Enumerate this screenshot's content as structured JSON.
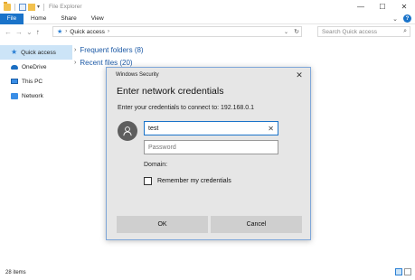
{
  "window": {
    "title": "File Explorer",
    "controls": {
      "minimize": "—",
      "maximize": "☐",
      "close": "✕"
    }
  },
  "ribbon": {
    "tabs": [
      "File",
      "Home",
      "Share",
      "View"
    ],
    "expand_glyph": "⌄",
    "help_glyph": "?"
  },
  "navigation": {
    "back": "←",
    "forward": "→",
    "recent": "⌄",
    "up": "↑"
  },
  "address": {
    "path": "Quick access",
    "separator": "›",
    "search_placeholder": "Search Quick access"
  },
  "sidebar": {
    "items": [
      {
        "label": "Quick access",
        "icon": "star-icon",
        "selected": true
      },
      {
        "label": "OneDrive",
        "icon": "cloud-icon",
        "selected": false
      },
      {
        "label": "This PC",
        "icon": "computer-icon",
        "selected": false
      },
      {
        "label": "Network",
        "icon": "network-icon",
        "selected": false
      }
    ]
  },
  "main": {
    "groups": [
      {
        "label": "Frequent folders (8)"
      },
      {
        "label": "Recent files (20)"
      }
    ]
  },
  "status": {
    "items_count": "28 items"
  },
  "dialog": {
    "title": "Windows Security",
    "heading": "Enter network credentials",
    "subtitle": "Enter your credentials to connect to: 192.168.0.1",
    "username_value": "test",
    "password_placeholder": "Password",
    "domain_label": "Domain:",
    "remember_label": "Remember my credentials",
    "remember_checked": false,
    "ok_label": "OK",
    "cancel_label": "Cancel"
  },
  "colors": {
    "accent": "#1a73c9",
    "selection": "#cce4f7",
    "link": "#1d5aa6",
    "dialog_bg": "#e6e6e6"
  }
}
